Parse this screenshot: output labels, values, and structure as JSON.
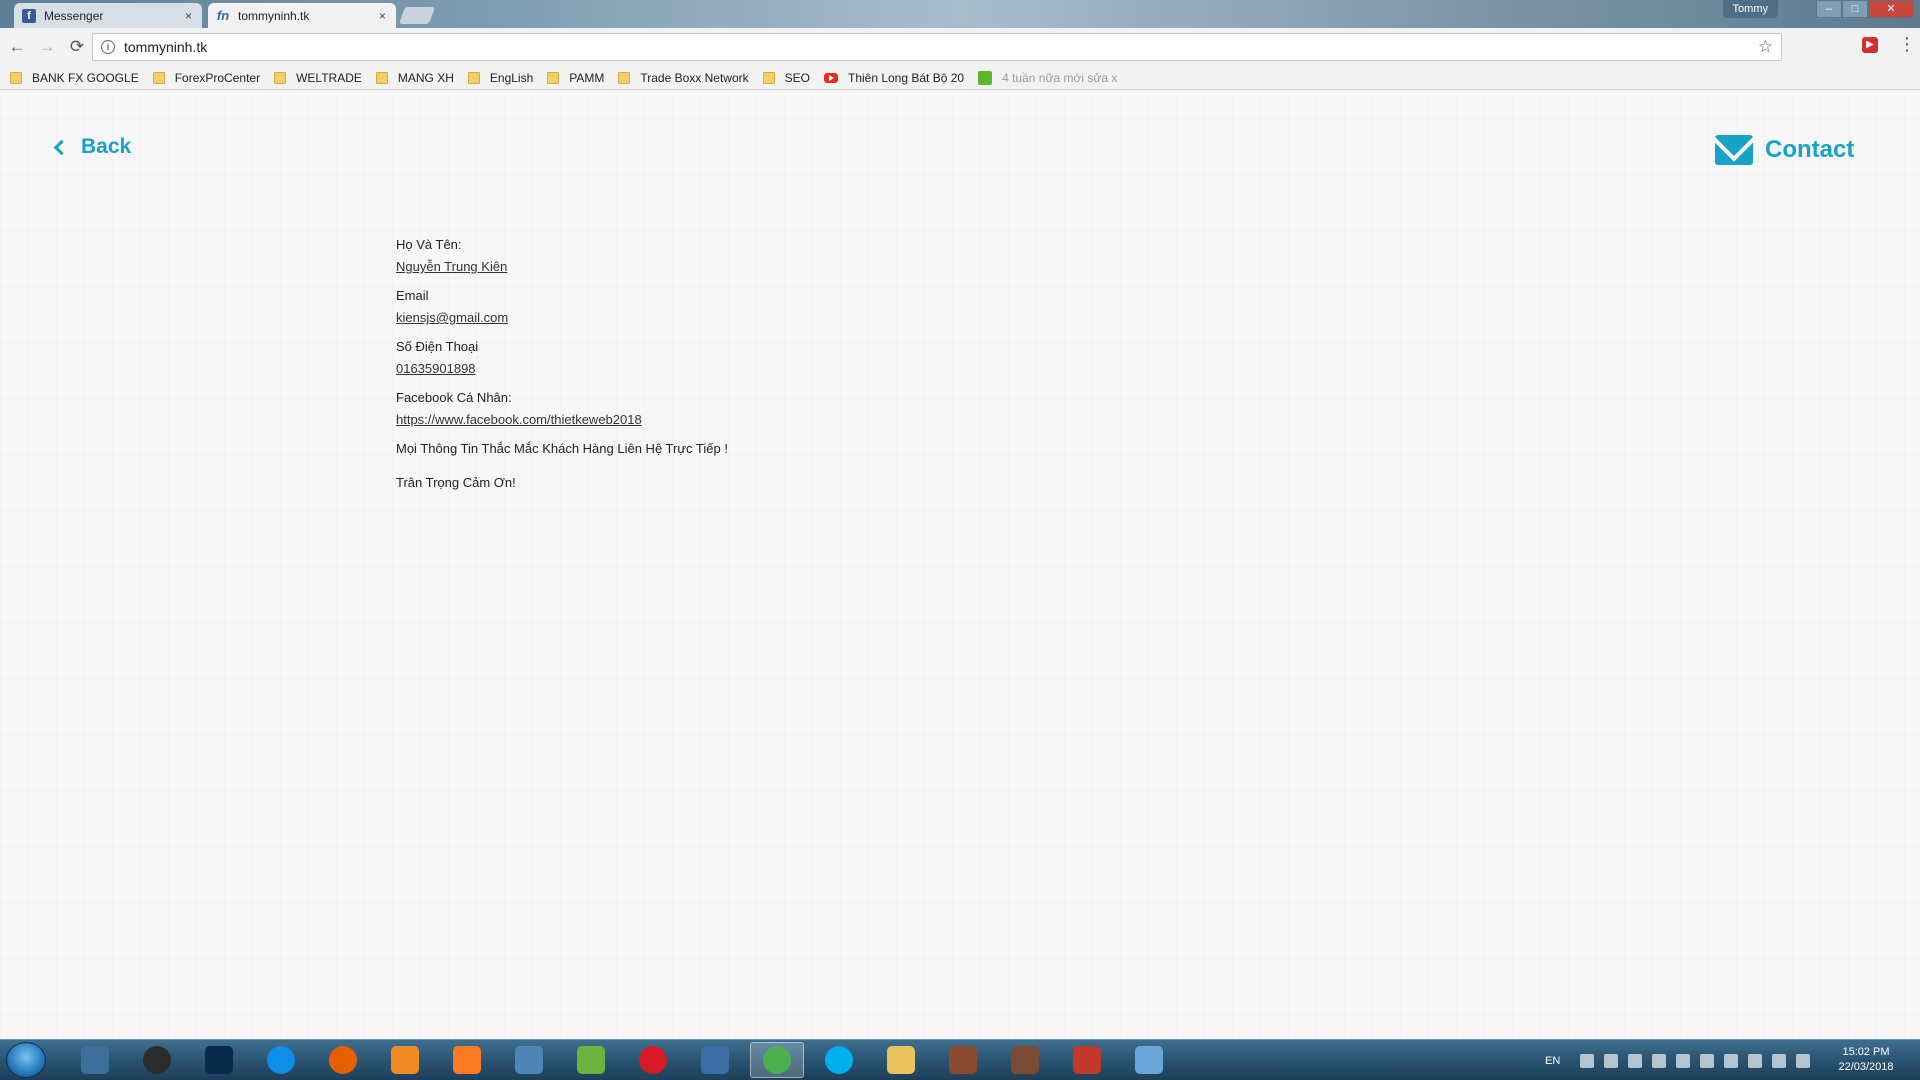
{
  "browser": {
    "tabs": [
      {
        "label": "Messenger",
        "icon": "facebook-icon"
      },
      {
        "label": "tommyninh.tk",
        "icon": "site-icon"
      }
    ],
    "window_user": "Tommy",
    "window_controls": {
      "minimize": "–",
      "maximize": "□",
      "close": "✕"
    },
    "tab_close": "×",
    "url": "tommyninh.tk",
    "nav": {
      "back": "←",
      "forward": "→",
      "reload": "⟳",
      "star": "☆",
      "menu": "⋮",
      "info": "i",
      "ext": "▶"
    }
  },
  "bookmarks": [
    {
      "label": "BANK FX GOOGLE",
      "icon": "folder"
    },
    {
      "label": "ForexProCenter",
      "icon": "folder"
    },
    {
      "label": "WELTRADE",
      "icon": "folder"
    },
    {
      "label": "MANG XH",
      "icon": "folder"
    },
    {
      "label": "EngLish",
      "icon": "folder"
    },
    {
      "label": "PAMM",
      "icon": "folder"
    },
    {
      "label": "Trade Boxx Network",
      "icon": "folder"
    },
    {
      "label": "SEO",
      "icon": "folder"
    },
    {
      "label": "Thiên Long Bát Bộ 20",
      "icon": "youtube"
    },
    {
      "label": "4 tuần nữa mới sửa x",
      "icon": "green"
    }
  ],
  "page": {
    "back_label": "Back",
    "contact_label": "Contact",
    "accent_color": "#17a2c7",
    "fields": [
      {
        "label": "Họ Và Tên:",
        "value": "Nguyễn Trung Kiên"
      },
      {
        "label": "Email",
        "value": "kiensjs@gmail.com"
      },
      {
        "label": "Số Điện Thoại",
        "value": "01635901898"
      },
      {
        "label": "Facebook Cá Nhân:",
        "value": "https://www.facebook.com/thietkeweb2018"
      }
    ],
    "notes": [
      "Mọi Thông Tin Thắc Mắc Khách Hàng Liên Hệ Trực Tiếp !",
      "Trân Trọng Cảm Ơn!"
    ]
  },
  "taskbar": {
    "apps": [
      {
        "name": "app-icon",
        "color": "#3c6f9c"
      },
      {
        "name": "obs-icon",
        "color": "#2b2b2b"
      },
      {
        "name": "photoshop-icon",
        "color": "#0a2a4a"
      },
      {
        "name": "teamviewer-icon",
        "color": "#0e8ee9"
      },
      {
        "name": "firefox-icon",
        "color": "#e66000"
      },
      {
        "name": "sublime-icon",
        "color": "#f08a24"
      },
      {
        "name": "xampp-icon",
        "color": "#fb7a24"
      },
      {
        "name": "app2-icon",
        "color": "#4f86b8"
      },
      {
        "name": "app3-icon",
        "color": "#6cb33f"
      },
      {
        "name": "opera-icon",
        "color": "#d61a28"
      },
      {
        "name": "app4-icon",
        "color": "#3a6ea5"
      },
      {
        "name": "chrome-icon",
        "color": "#4caf50"
      },
      {
        "name": "skype-icon",
        "color": "#00aff0"
      },
      {
        "name": "explorer-icon",
        "color": "#e8c25a"
      },
      {
        "name": "game1-icon",
        "color": "#8a4b32"
      },
      {
        "name": "game2-icon",
        "color": "#7a4a35"
      },
      {
        "name": "app5-icon",
        "color": "#c0392b"
      },
      {
        "name": "paint-icon",
        "color": "#6aa6d8"
      }
    ],
    "language": "EN",
    "time": "15:02 PM",
    "date": "22/03/2018"
  }
}
